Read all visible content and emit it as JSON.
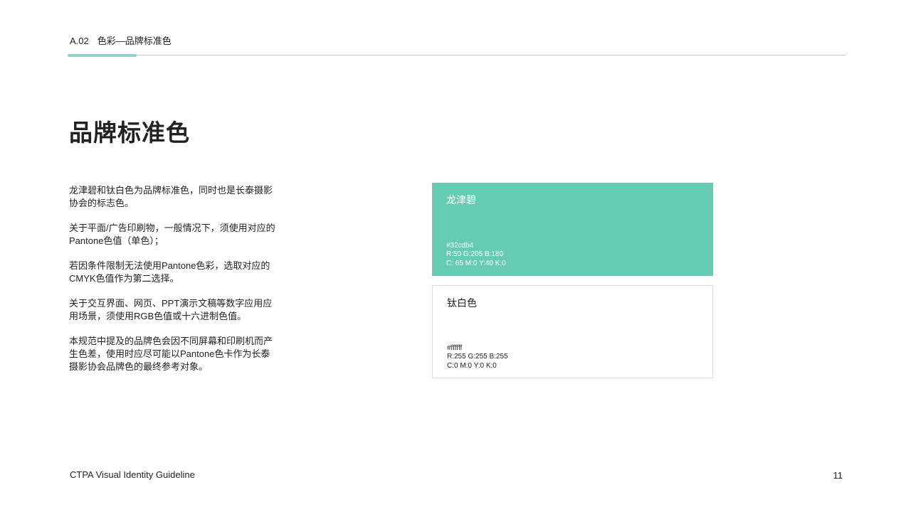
{
  "header": {
    "section_code": "A.02",
    "section_title": "色彩—品牌标准色"
  },
  "page_title": "品牌标准色",
  "paragraphs": [
    "龙津碧和钛白色为品牌标准色，同时也是长泰摄影协会的标志色。",
    "关于平面/广告印刷物，一般情况下，须使用对应的Pantone色值（单色）；",
    "若因条件限制无法使用Pantone色彩，选取对应的CMYK色值作为第二选择。",
    "关于交互界面、网页、PPT演示文稿等数字应用应用场景，须使用RGB色值或十六进制色值。",
    "本规范中提及的品牌色会因不同屏幕和印刷机而产生色差，使用时应尽可能以Pantone色卡作为长泰摄影协会品牌色的最终参考对象。"
  ],
  "swatches": [
    {
      "name": "龙津碧",
      "hex": "#32cdb4",
      "rgb": "R:50 G:205 B:180",
      "cmyk": "C: 65 M:0  Y:40  K:0",
      "fill_color": "#67cbb4"
    },
    {
      "name": "钛白色",
      "hex": "#ffffff",
      "rgb": "R:255 G:255 B:255",
      "cmyk": "C:0  M:0  Y:0  K:0",
      "fill_color": "#ffffff"
    }
  ],
  "footer": {
    "guideline_name": "CTPA Visual Identity Guideline",
    "page_number": "11"
  },
  "colors": {
    "accent": "#8fd4c8",
    "rule": "#c9c9c9",
    "text": "#222222"
  }
}
